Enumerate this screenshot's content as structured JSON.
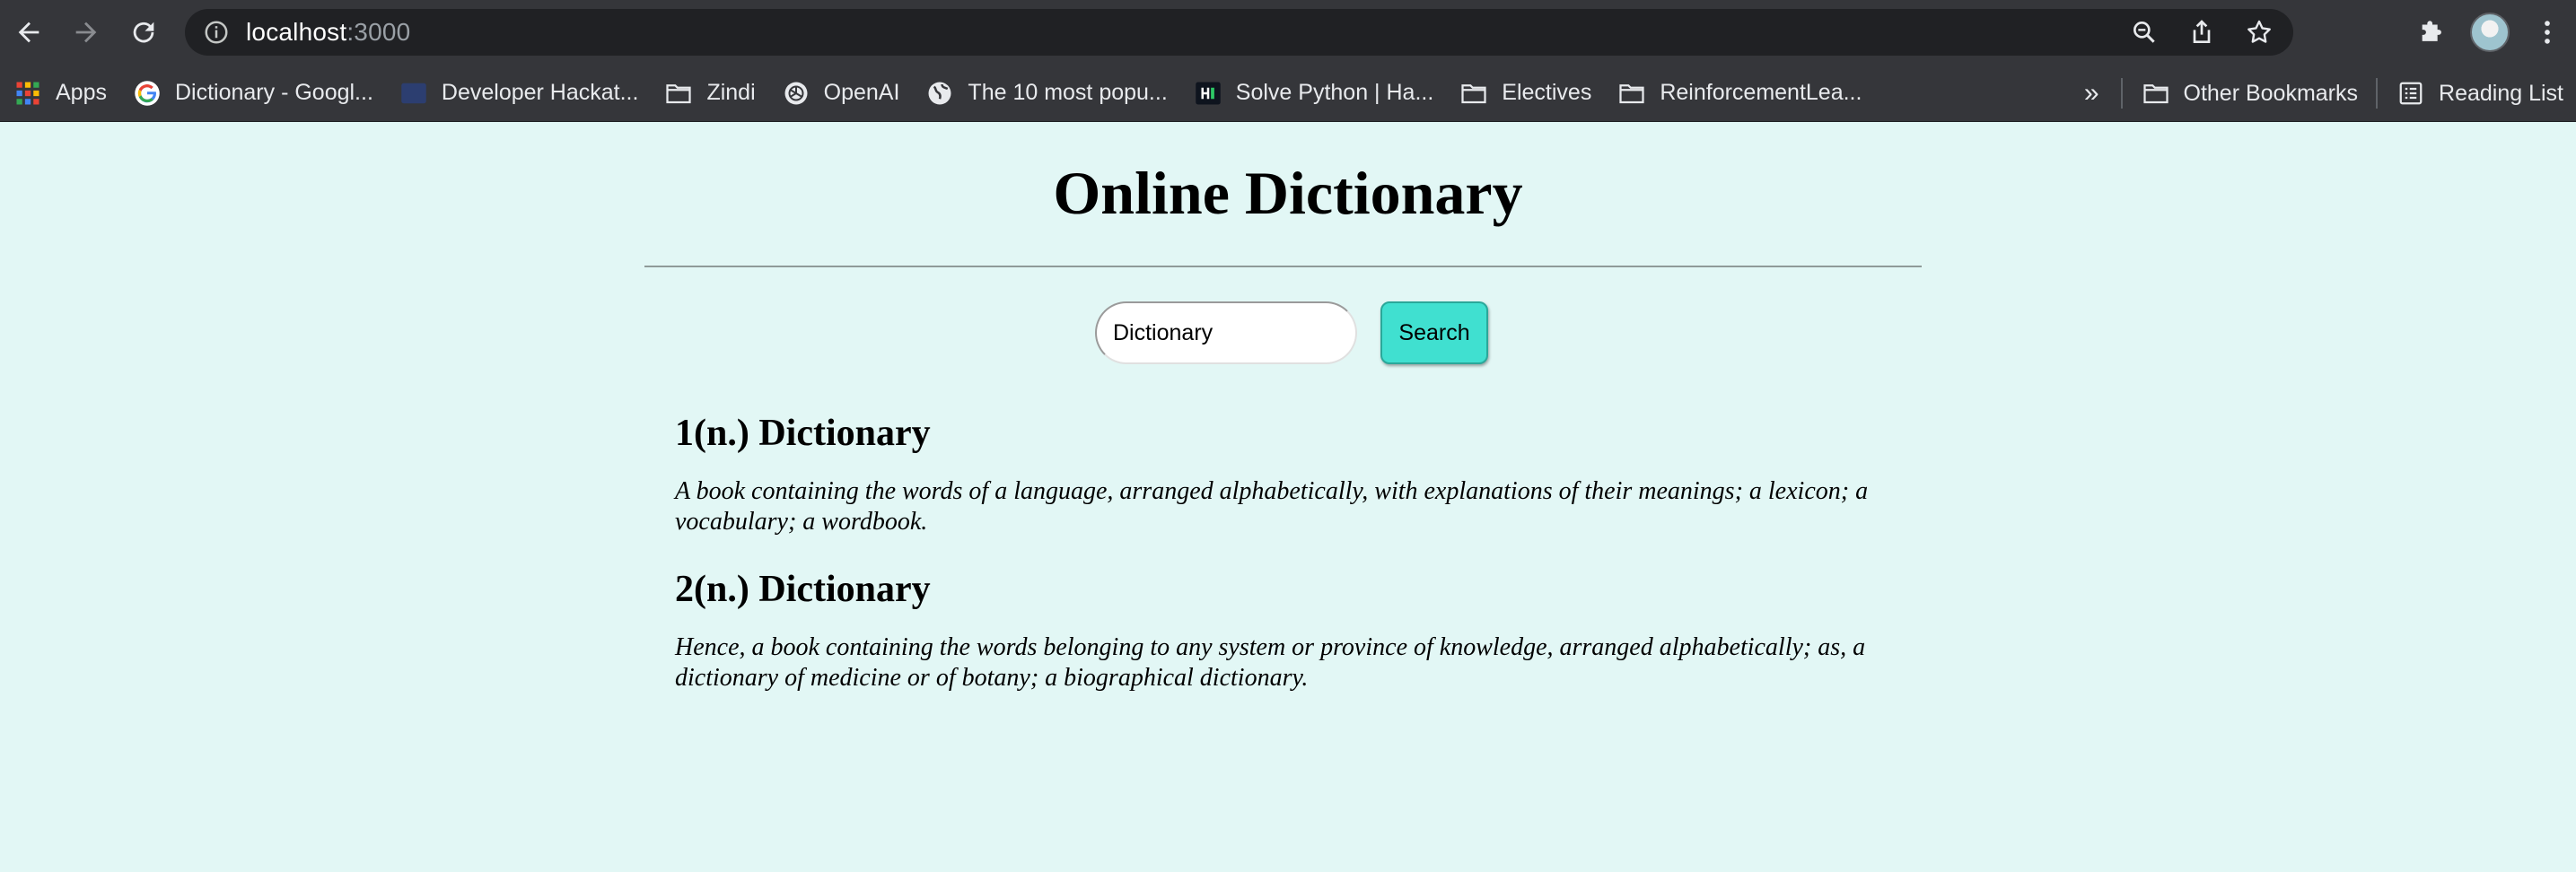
{
  "browser": {
    "url_host": "localhost",
    "url_port": ":3000",
    "bookmarks": [
      {
        "label": "Apps",
        "icon": "apps-grid-icon"
      },
      {
        "label": "Dictionary - Googl...",
        "icon": "google-icon"
      },
      {
        "label": "Developer Hackat...",
        "icon": "devpost-icon"
      },
      {
        "label": "Zindi",
        "icon": "folder-icon"
      },
      {
        "label": "OpenAI",
        "icon": "openai-icon"
      },
      {
        "label": "The 10 most popu...",
        "icon": "globe-icon"
      },
      {
        "label": "Solve Python | Ha...",
        "icon": "hackerrank-icon"
      },
      {
        "label": "Electives",
        "icon": "folder-icon"
      },
      {
        "label": "ReinforcementLea...",
        "icon": "folder-icon"
      }
    ],
    "overflow_label": "»",
    "other_bookmarks": "Other Bookmarks",
    "reading_list": "Reading List"
  },
  "page": {
    "title": "Online Dictionary",
    "search": {
      "value": "Dictionary",
      "button_label": "Search"
    },
    "entries": [
      {
        "heading": "1(n.) Dictionary",
        "definition": "A book containing the words of a language, arranged alphabetically, with explanations of their meanings; a lexicon; a vocabulary; a wordbook."
      },
      {
        "heading": "2(n.) Dictionary",
        "definition": "Hence, a book containing the words belonging to any system or province of knowledge, arranged alphabetically; as, a dictionary of medicine or of botany; a biographical dictionary."
      }
    ]
  },
  "colors": {
    "page_background": "#e2f7f5",
    "search_button": "#40e0d0",
    "chrome_toolbar": "#35363a"
  }
}
